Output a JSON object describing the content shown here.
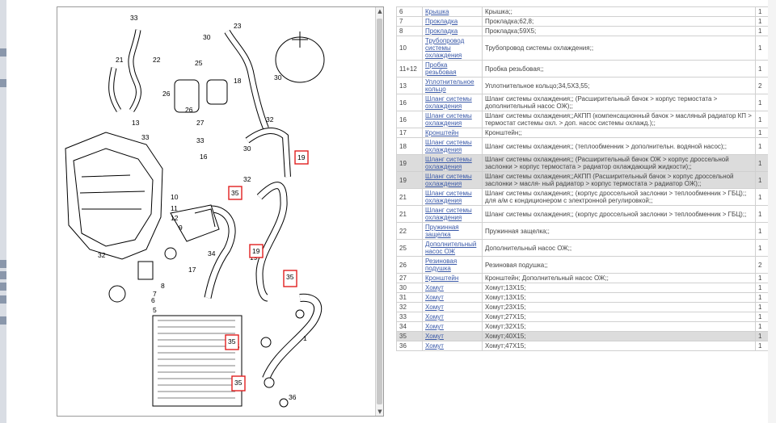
{
  "diagram": {
    "callouts": [
      "33",
      "30",
      "23",
      "21",
      "22",
      "25",
      "18",
      "30",
      "26",
      "26",
      "27",
      "13",
      "33",
      "33",
      "16",
      "32",
      "30",
      "19",
      "32",
      "35",
      "10",
      "11",
      "12",
      "9",
      "19",
      "34",
      "32",
      "17",
      "8",
      "7",
      "6",
      "5",
      "35",
      "35",
      "35",
      "36",
      "1"
    ],
    "highlight_labels": [
      "19",
      "35",
      "19",
      "35",
      "35",
      "35"
    ]
  },
  "table": {
    "rows": [
      {
        "pos": "6",
        "name": "Крышка",
        "desc": "Крышка;;",
        "qty": "1",
        "hl": false
      },
      {
        "pos": "7",
        "name": "Прокладка",
        "desc": "Прокладка;62,8;",
        "qty": "1",
        "hl": false
      },
      {
        "pos": "8",
        "name": "Прокладка",
        "desc": "Прокладка;59X5;",
        "qty": "1",
        "hl": false
      },
      {
        "pos": "10",
        "name": "Трубопровод системы охлаждения",
        "desc": "Трубопровод системы охлаждения;;",
        "qty": "1",
        "hl": false
      },
      {
        "pos": "11+12",
        "name": "Пробка резьбовая",
        "desc": "Пробка резьбовая;;",
        "qty": "1",
        "hl": false
      },
      {
        "pos": "13",
        "name": "Уплотнительное кольцо",
        "desc": "Уплотнительное кольцо;34,5X3,55;",
        "qty": "2",
        "hl": false
      },
      {
        "pos": "16",
        "name": "Шланг системы охлаждения",
        "desc": "Шланг системы охлаждения;; (Расширительный бачок > корпус термостата > дополнительный насос ОЖ);;",
        "qty": "1",
        "hl": false
      },
      {
        "pos": "16",
        "name": "Шланг системы охлаждения",
        "desc": "Шланг системы охлаждения;;АКПП (компенсационный бачок > масляный радиатор КП > термостат системы охл. > доп. насос системы охлажд.);;",
        "qty": "1",
        "hl": false
      },
      {
        "pos": "17",
        "name": "Кронштейн",
        "desc": "Кронштейн;;",
        "qty": "1",
        "hl": false
      },
      {
        "pos": "18",
        "name": "Шланг системы охлаждения",
        "desc": "Шланг системы охлаждения;; (теплообменник > дополнительн. водяной насос);;",
        "qty": "1",
        "hl": false
      },
      {
        "pos": "19",
        "name": "Шланг системы охлаждения",
        "desc": "Шланг системы охлаждения;; (Расширительный бачок ОЖ > корпус дроссельной заслонки > корпус термостата > радиатор охлаждающий жидкости);;",
        "qty": "1",
        "hl": true
      },
      {
        "pos": "19",
        "name": "Шланг системы охлаждения",
        "desc": "Шланг системы охлаждения;;АКПП (Расширительный бачок > корпус дроссельной заслонки > масля- ный радиатор > корпус термостата > радиатор ОЖ);;",
        "qty": "1",
        "hl": true
      },
      {
        "pos": "21",
        "name": "Шланг системы охлаждения",
        "desc": "Шланг системы охлаждения;; (корпус дроссельной заслонки > теплообменник > ГБЦ);; для а/м с кондиционером с электронной регулировкой;;",
        "qty": "1",
        "hl": false
      },
      {
        "pos": "21",
        "name": "Шланг системы охлаждения",
        "desc": "Шланг системы охлаждения;; (корпус дроссельной заслонки > теплообменник > ГБЦ);;",
        "qty": "1",
        "hl": false
      },
      {
        "pos": "22",
        "name": "Пружинная защелка",
        "desc": "Пружинная защелка;;",
        "qty": "1",
        "hl": false
      },
      {
        "pos": "25",
        "name": "Дополнительный насос ОЖ",
        "desc": "Дополнительный насос ОЖ;;",
        "qty": "1",
        "hl": false
      },
      {
        "pos": "26",
        "name": "Резиновая подушка",
        "desc": "Резиновая подушка;;",
        "qty": "2",
        "hl": false
      },
      {
        "pos": "27",
        "name": "Кронштейн",
        "desc": "Кронштейн; Дополнительный насос ОЖ;;",
        "qty": "1",
        "hl": false
      },
      {
        "pos": "30",
        "name": "Хомут",
        "desc": "Хомут;13X15;",
        "qty": "1",
        "hl": false
      },
      {
        "pos": "31",
        "name": "Хомут",
        "desc": "Хомут;13X15;",
        "qty": "1",
        "hl": false
      },
      {
        "pos": "32",
        "name": "Хомут",
        "desc": "Хомут;23X15;",
        "qty": "1",
        "hl": false
      },
      {
        "pos": "33",
        "name": "Хомут",
        "desc": "Хомут;27X15;",
        "qty": "1",
        "hl": false
      },
      {
        "pos": "34",
        "name": "Хомут",
        "desc": "Хомут;32X15;",
        "qty": "1",
        "hl": false
      },
      {
        "pos": "35",
        "name": "Хомут",
        "desc": "Хомут;40X15;",
        "qty": "1",
        "hl": true
      },
      {
        "pos": "36",
        "name": "Хомут",
        "desc": "Хомут;47X15;",
        "qty": "1",
        "hl": false
      }
    ]
  }
}
